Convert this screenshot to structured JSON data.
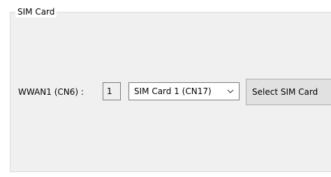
{
  "groupbox": {
    "title": "SIM Card"
  },
  "wwan": {
    "label": "WWAN1 (CN6) :",
    "value": "1"
  },
  "sim_select": {
    "selected": "SIM Card 1 (CN17)",
    "icon": "chevron-down-icon"
  },
  "actions": {
    "select_sim_label": "Select SIM Card"
  }
}
